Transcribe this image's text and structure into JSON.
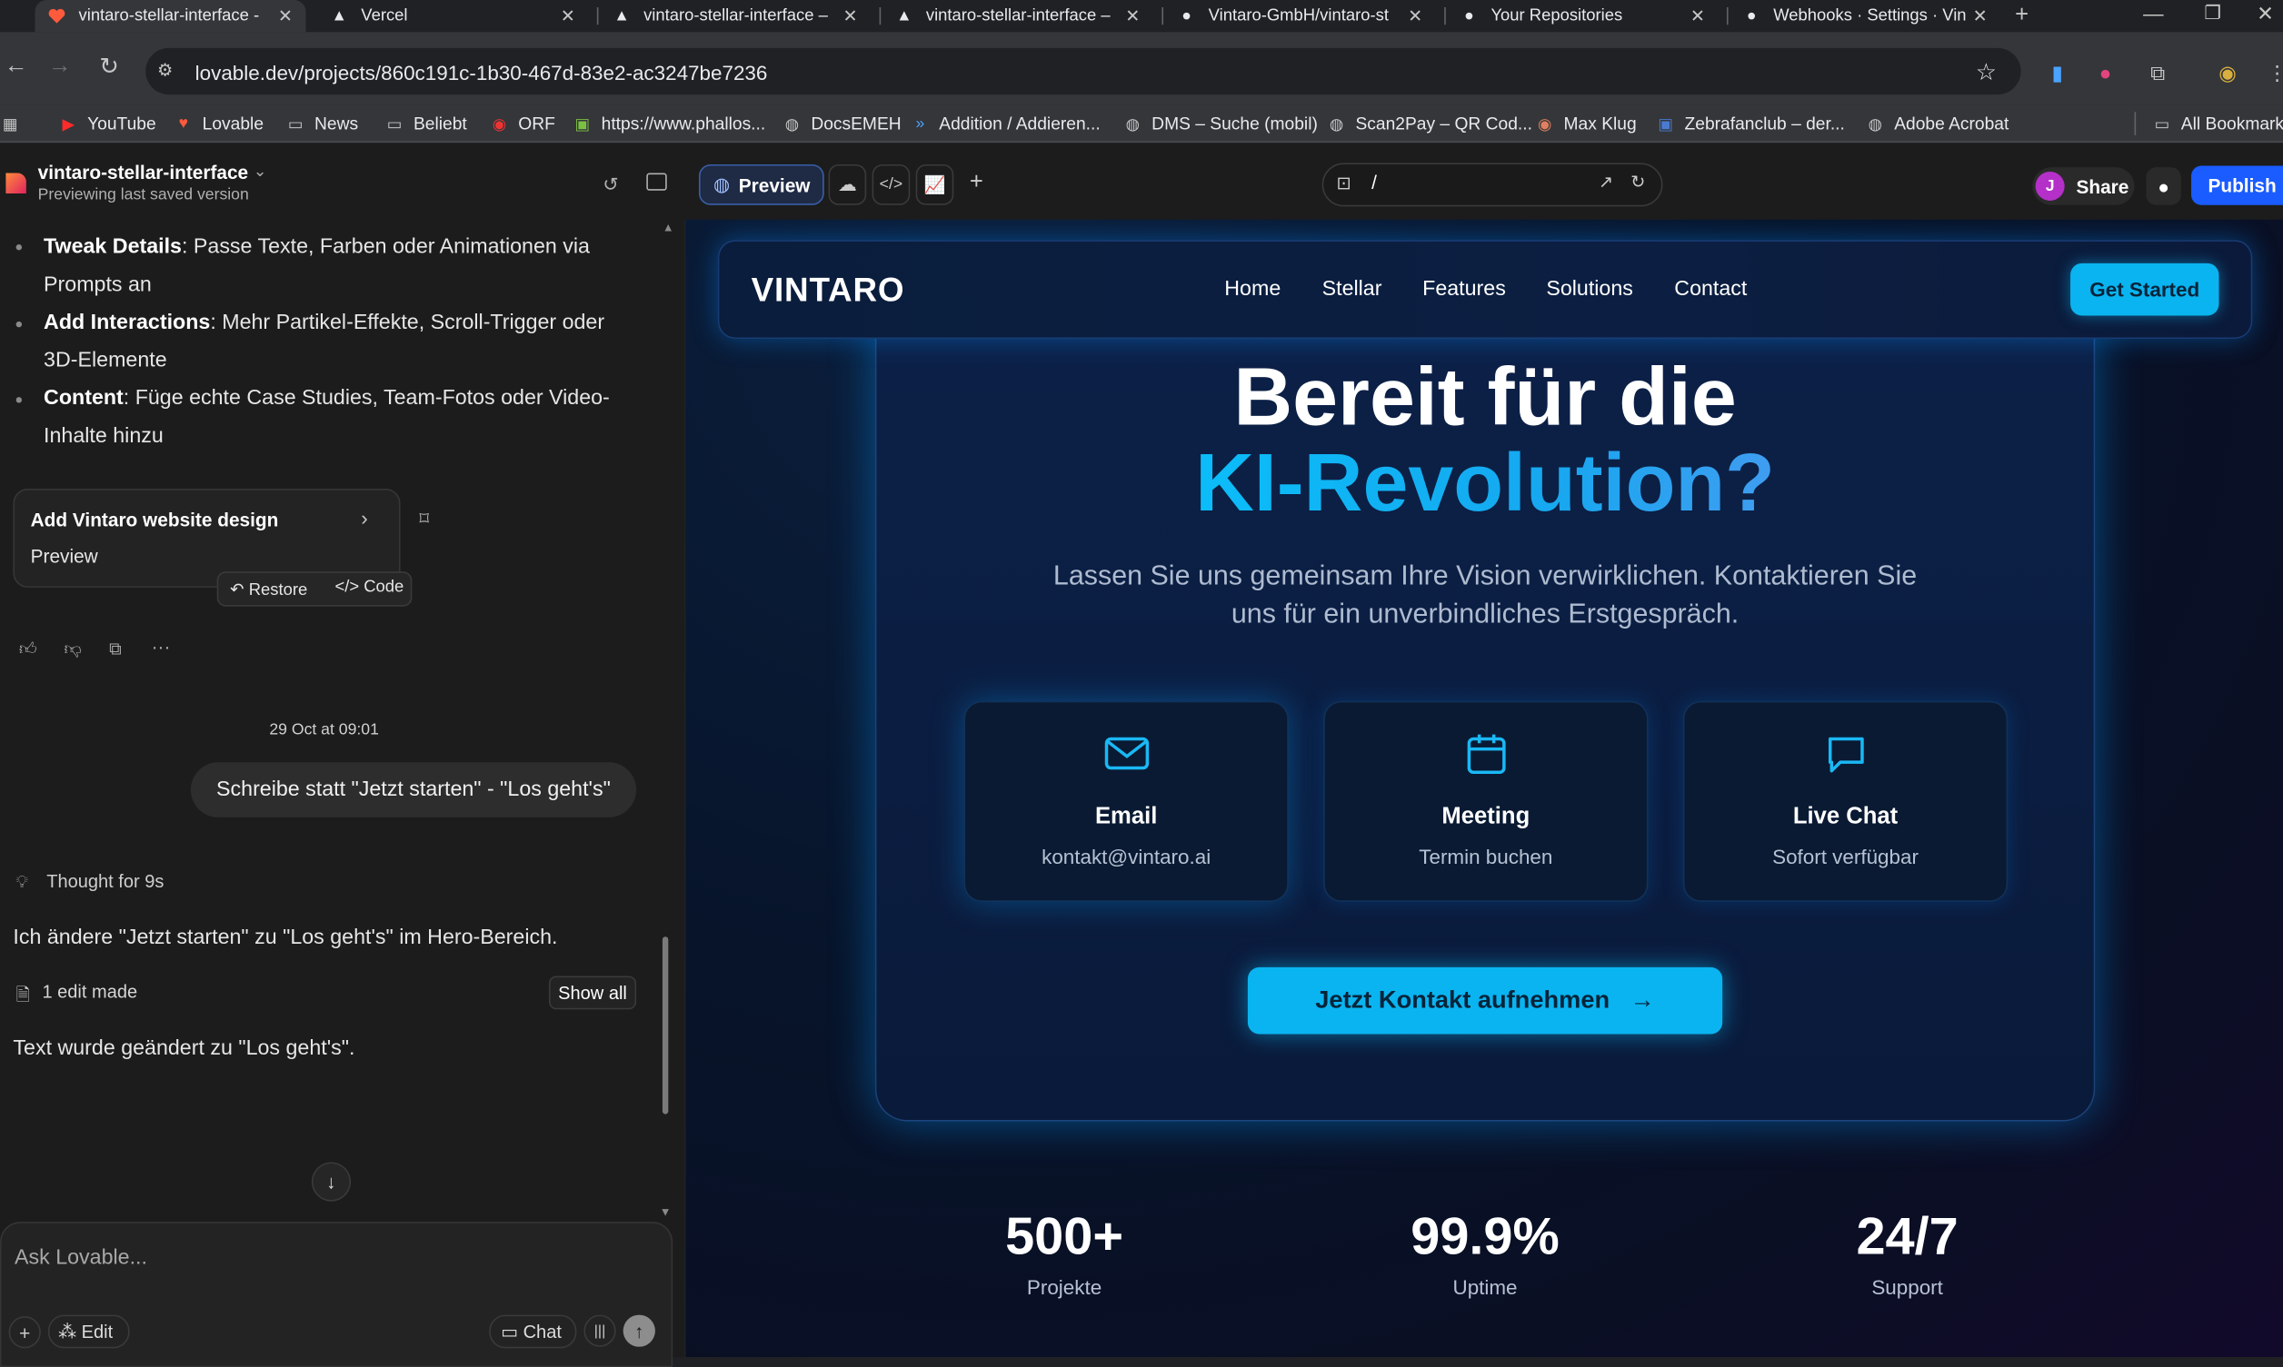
{
  "browser": {
    "tabs": [
      {
        "title": "vintaro-stellar-interface -",
        "icon": "lovable-icon"
      },
      {
        "title": "Vercel",
        "icon": "vercel-icon"
      },
      {
        "title": "vintaro-stellar-interface –",
        "icon": "vercel-icon"
      },
      {
        "title": "vintaro-stellar-interface –",
        "icon": "vercel-icon"
      },
      {
        "title": "Vintaro-GmbH/vintaro-st",
        "icon": "github-icon"
      },
      {
        "title": "Your Repositories",
        "icon": "github-icon"
      },
      {
        "title": "Webhooks · Settings · Vin",
        "icon": "github-icon"
      }
    ],
    "url": "lovable.dev/projects/860c191c-1b30-467d-83e2-ac3247be7236",
    "bookmarks": [
      "YouTube",
      "Lovable",
      "News",
      "Beliebt",
      "ORF",
      "https://www.phallos...",
      "DocsEMEH",
      "Addition / Addieren...",
      "DMS – Suche (mobil)",
      "Scan2Pay – QR Cod...",
      "Max Klug",
      "Zebrafanclub – der...",
      "Adobe Acrobat"
    ],
    "all_bookmarks": "All Bookmarks"
  },
  "lovable": {
    "project_name": "vintaro-stellar-interface",
    "project_status": "Previewing last saved version",
    "preview_label": "Preview",
    "path": "/",
    "avatar_letter": "J",
    "share_label": "Share",
    "publish_label": "Publish"
  },
  "chat": {
    "bullets": [
      {
        "bold": "Tweak Details",
        "text": ": Passe Texte, Farben oder Animationen via",
        "text2": "Prompts an"
      },
      {
        "bold": "Add Interactions",
        "text": ": Mehr Partikel-Effekte, Scroll-Trigger oder",
        "text2": "3D-Elemente"
      },
      {
        "bold": "Content",
        "text": ": Füge echte Case Studies, Team-Fotos oder Video-",
        "text2": "Inhalte hinzu"
      }
    ],
    "version_card": {
      "title": "Add Vintaro website design",
      "sub": "Preview",
      "restore": "Restore",
      "code": "Code"
    },
    "timestamp": "29 Oct at 09:01",
    "user_message": "Schreibe statt \"Jetzt starten\" - \"Los geht's\"",
    "thought": "Thought for 9s",
    "reply1": "Ich ändere \"Jetzt starten\" zu \"Los geht's\" im Hero-Bereich.",
    "edits": "1 edit made",
    "show_all": "Show all",
    "reply2": "Text wurde geändert zu \"Los geht's\".",
    "input_placeholder": "Ask Lovable...",
    "edit_label": "Edit",
    "chat_label": "Chat"
  },
  "site": {
    "logo": "VINTARO",
    "nav": [
      "Home",
      "Stellar",
      "Features",
      "Solutions",
      "Contact"
    ],
    "cta": "Get Started",
    "headline1": "Bereit für die",
    "headline2": "KI-Revolution?",
    "subtext1": "Lassen Sie uns gemeinsam Ihre Vision verwirklichen. Kontaktieren Sie",
    "subtext2": "uns für ein unverbindliches Erstgespräch.",
    "cards": [
      {
        "title": "Email",
        "sub": "kontakt@vintaro.ai",
        "icon": "mail-icon"
      },
      {
        "title": "Meeting",
        "sub": "Termin buchen",
        "icon": "calendar-icon"
      },
      {
        "title": "Live Chat",
        "sub": "Sofort verfügbar",
        "icon": "chat-bubble-icon"
      }
    ],
    "contact_button": "Jetzt Kontakt aufnehmen",
    "stats": [
      {
        "value": "500+",
        "label": "Projekte"
      },
      {
        "value": "99.9%",
        "label": "Uptime"
      },
      {
        "value": "24/7",
        "label": "Support"
      }
    ]
  },
  "colors": {
    "accent": "#0ab4f0",
    "publish": "#1a5cff",
    "bg": "#1c1c1c"
  }
}
